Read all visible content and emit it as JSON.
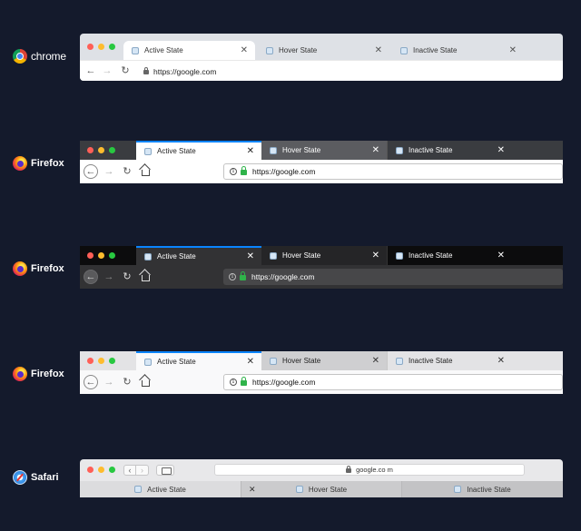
{
  "colors": {
    "background": "#141a2c",
    "firefox_accent": "#0a84ff",
    "secure_lock": "#2fb34a"
  },
  "chrome": {
    "brand": "chrome",
    "tabs": [
      {
        "label": "Active State",
        "state": "active"
      },
      {
        "label": "Hover State",
        "state": "hover"
      },
      {
        "label": "Inactive State",
        "state": "inactive"
      }
    ],
    "url": "https://google.com",
    "icons": [
      "back-arrow-icon",
      "forward-arrow-icon",
      "reload-icon",
      "lock-icon",
      "close-icon"
    ]
  },
  "firefox_dark_tabs": {
    "brand": "Firefox",
    "tabs": [
      {
        "label": "Active State",
        "state": "active"
      },
      {
        "label": "Hover State",
        "state": "hover"
      },
      {
        "label": "Inactive State",
        "state": "inactive"
      }
    ],
    "url": "https://google.com"
  },
  "firefox_dark": {
    "brand": "Firefox",
    "tabs": [
      {
        "label": "Active State",
        "state": "active"
      },
      {
        "label": "Hover State",
        "state": "hover"
      },
      {
        "label": "Inactive State",
        "state": "inactive"
      }
    ],
    "url": "https://google.com"
  },
  "firefox_light": {
    "brand": "Firefox",
    "tabs": [
      {
        "label": "Active State",
        "state": "active"
      },
      {
        "label": "Hover State",
        "state": "hover"
      },
      {
        "label": "Inactive State",
        "state": "inactive"
      }
    ],
    "url": "https://google.com"
  },
  "safari": {
    "brand": "Safari",
    "url": "google.co m",
    "tabs": [
      {
        "label": "Active State",
        "state": "active"
      },
      {
        "label": "Hover State",
        "state": "hover"
      },
      {
        "label": "Inactive State",
        "state": "inactive"
      }
    ],
    "icons": [
      "back-chevron-icon",
      "forward-chevron-icon",
      "sidebar-icon",
      "lock-icon"
    ]
  },
  "glyphs": {
    "close": "✕",
    "back": "←",
    "forward": "→",
    "reload": "↻",
    "chev_left": "‹",
    "chev_right": "›",
    "info": "i"
  }
}
